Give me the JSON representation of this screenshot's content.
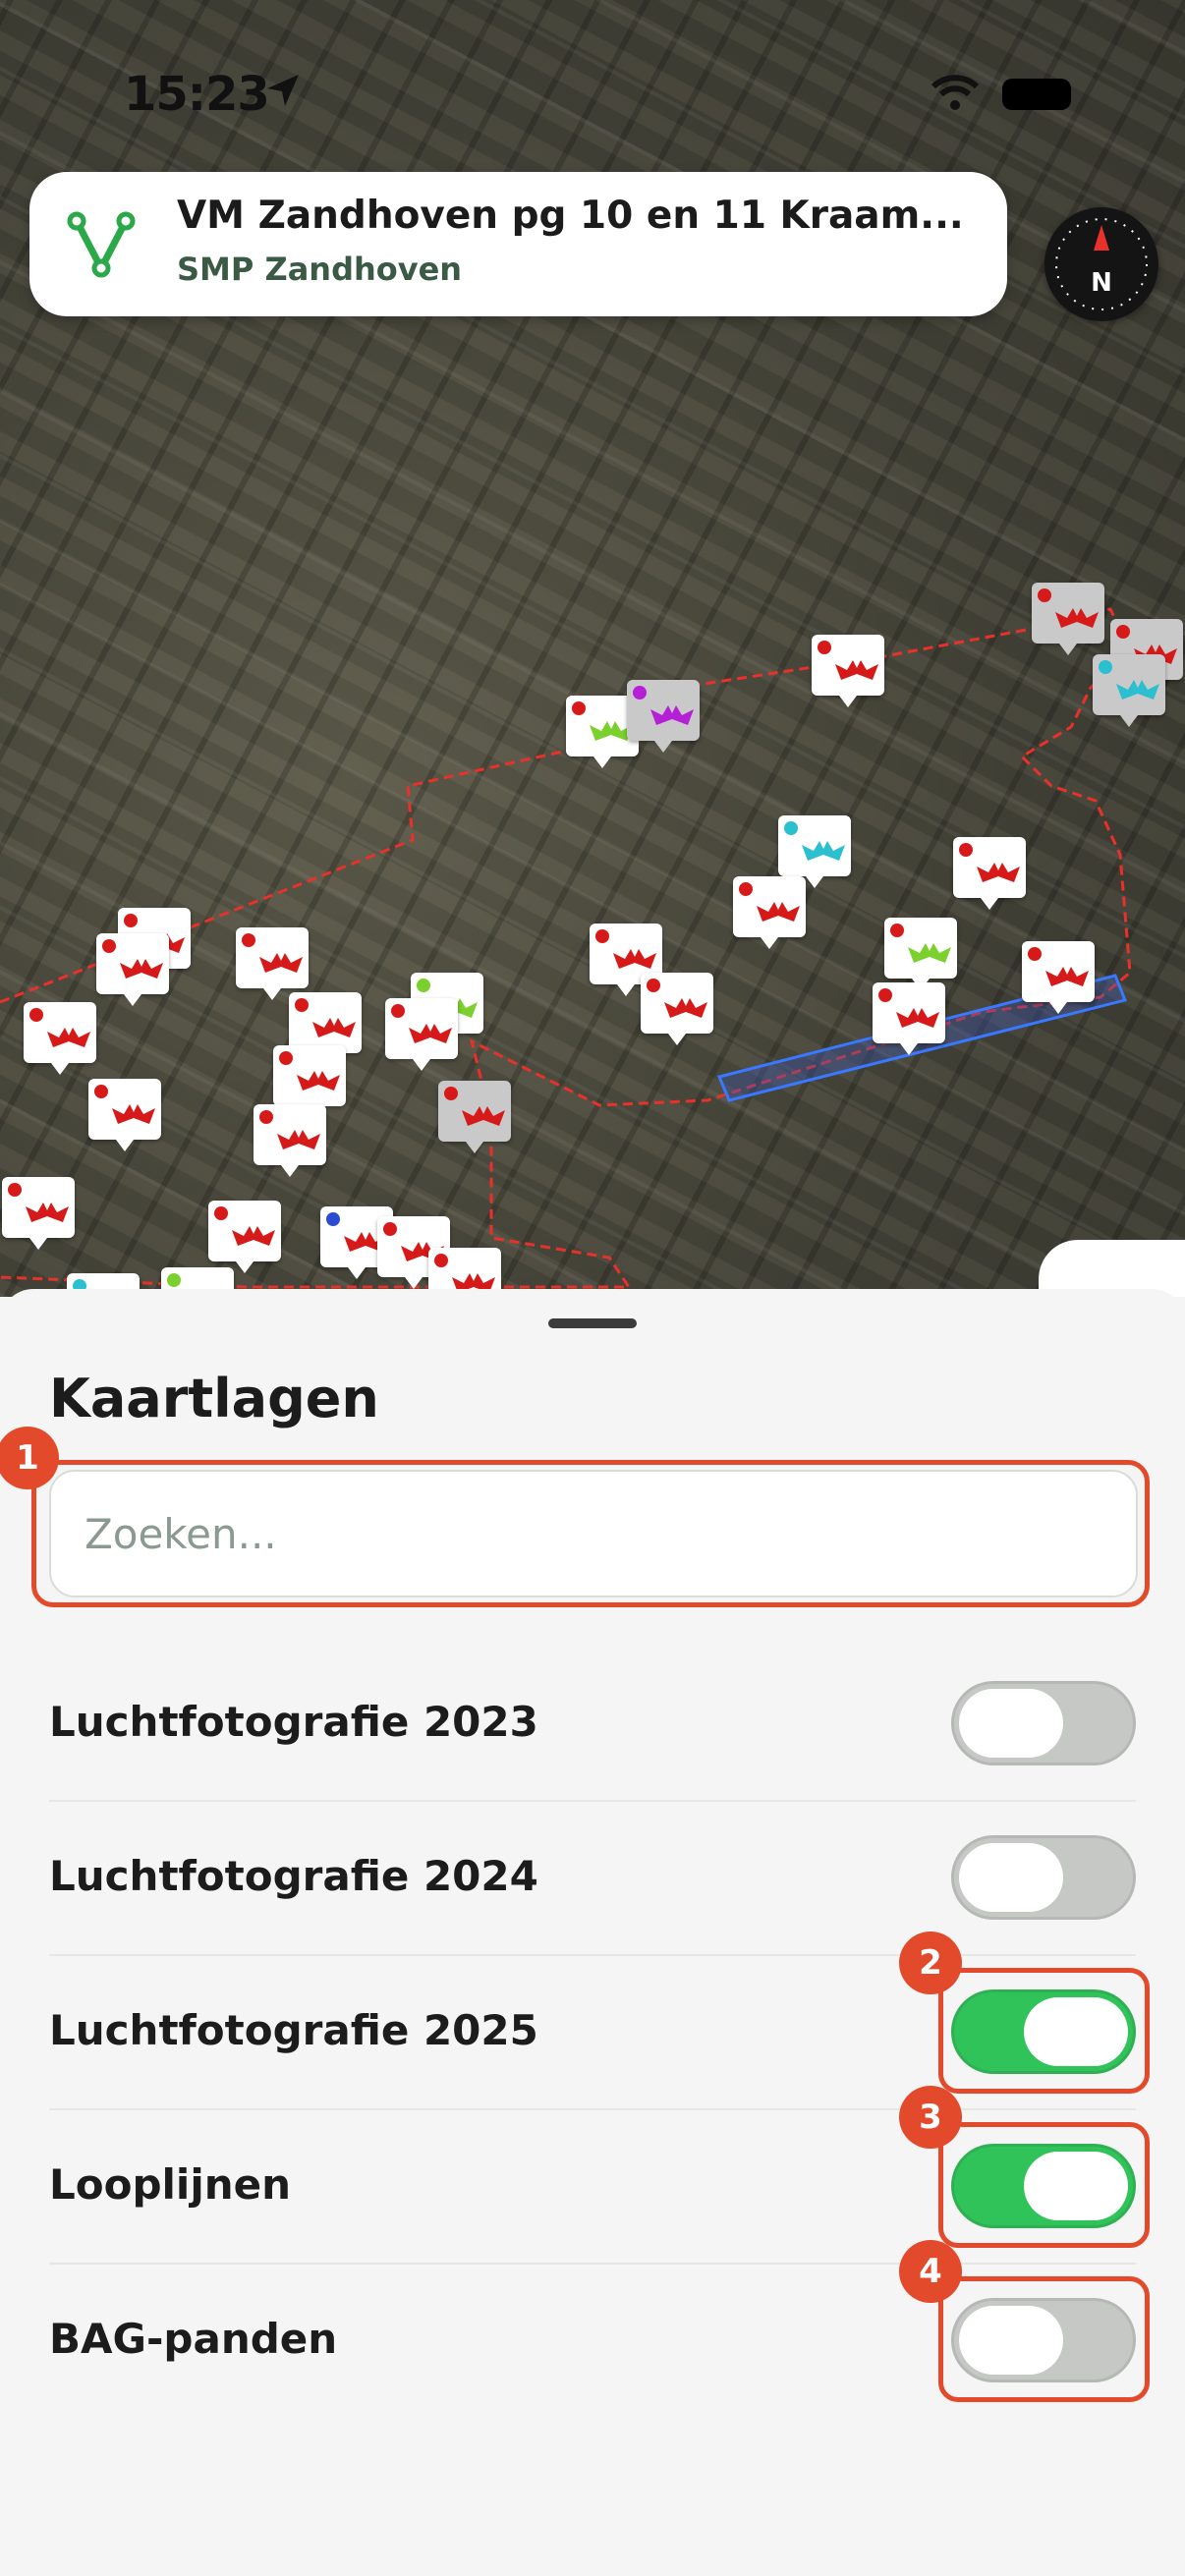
{
  "status_bar": {
    "time": "15:23"
  },
  "project": {
    "title": "VM Zandhoven pg 10 en 11 Kraam...",
    "subtitle": "SMP Zandhoven",
    "logo_icon": "app-logo-icon"
  },
  "compass": {
    "label": "N"
  },
  "sheet": {
    "title": "Kaartlagen",
    "search": {
      "placeholder": "Zoeken...",
      "value": ""
    },
    "layers": [
      {
        "label": "Luchtfotografie 2023",
        "enabled": false
      },
      {
        "label": "Luchtfotografie 2024",
        "enabled": false
      },
      {
        "label": "Luchtfotografie 2025",
        "enabled": true
      },
      {
        "label": "Looplijnen",
        "enabled": true
      },
      {
        "label": "BAG-panden",
        "enabled": false
      }
    ]
  },
  "annotations": {
    "badges": [
      "1",
      "2",
      "3",
      "4"
    ]
  },
  "colors": {
    "accent_green": "#2fc35a",
    "annotation_orange": "#e24a2b",
    "marker_red": "#d61a1a",
    "marker_cyan": "#2bbfd0",
    "marker_green": "#7bd02e",
    "marker_purple": "#b51fd6"
  }
}
